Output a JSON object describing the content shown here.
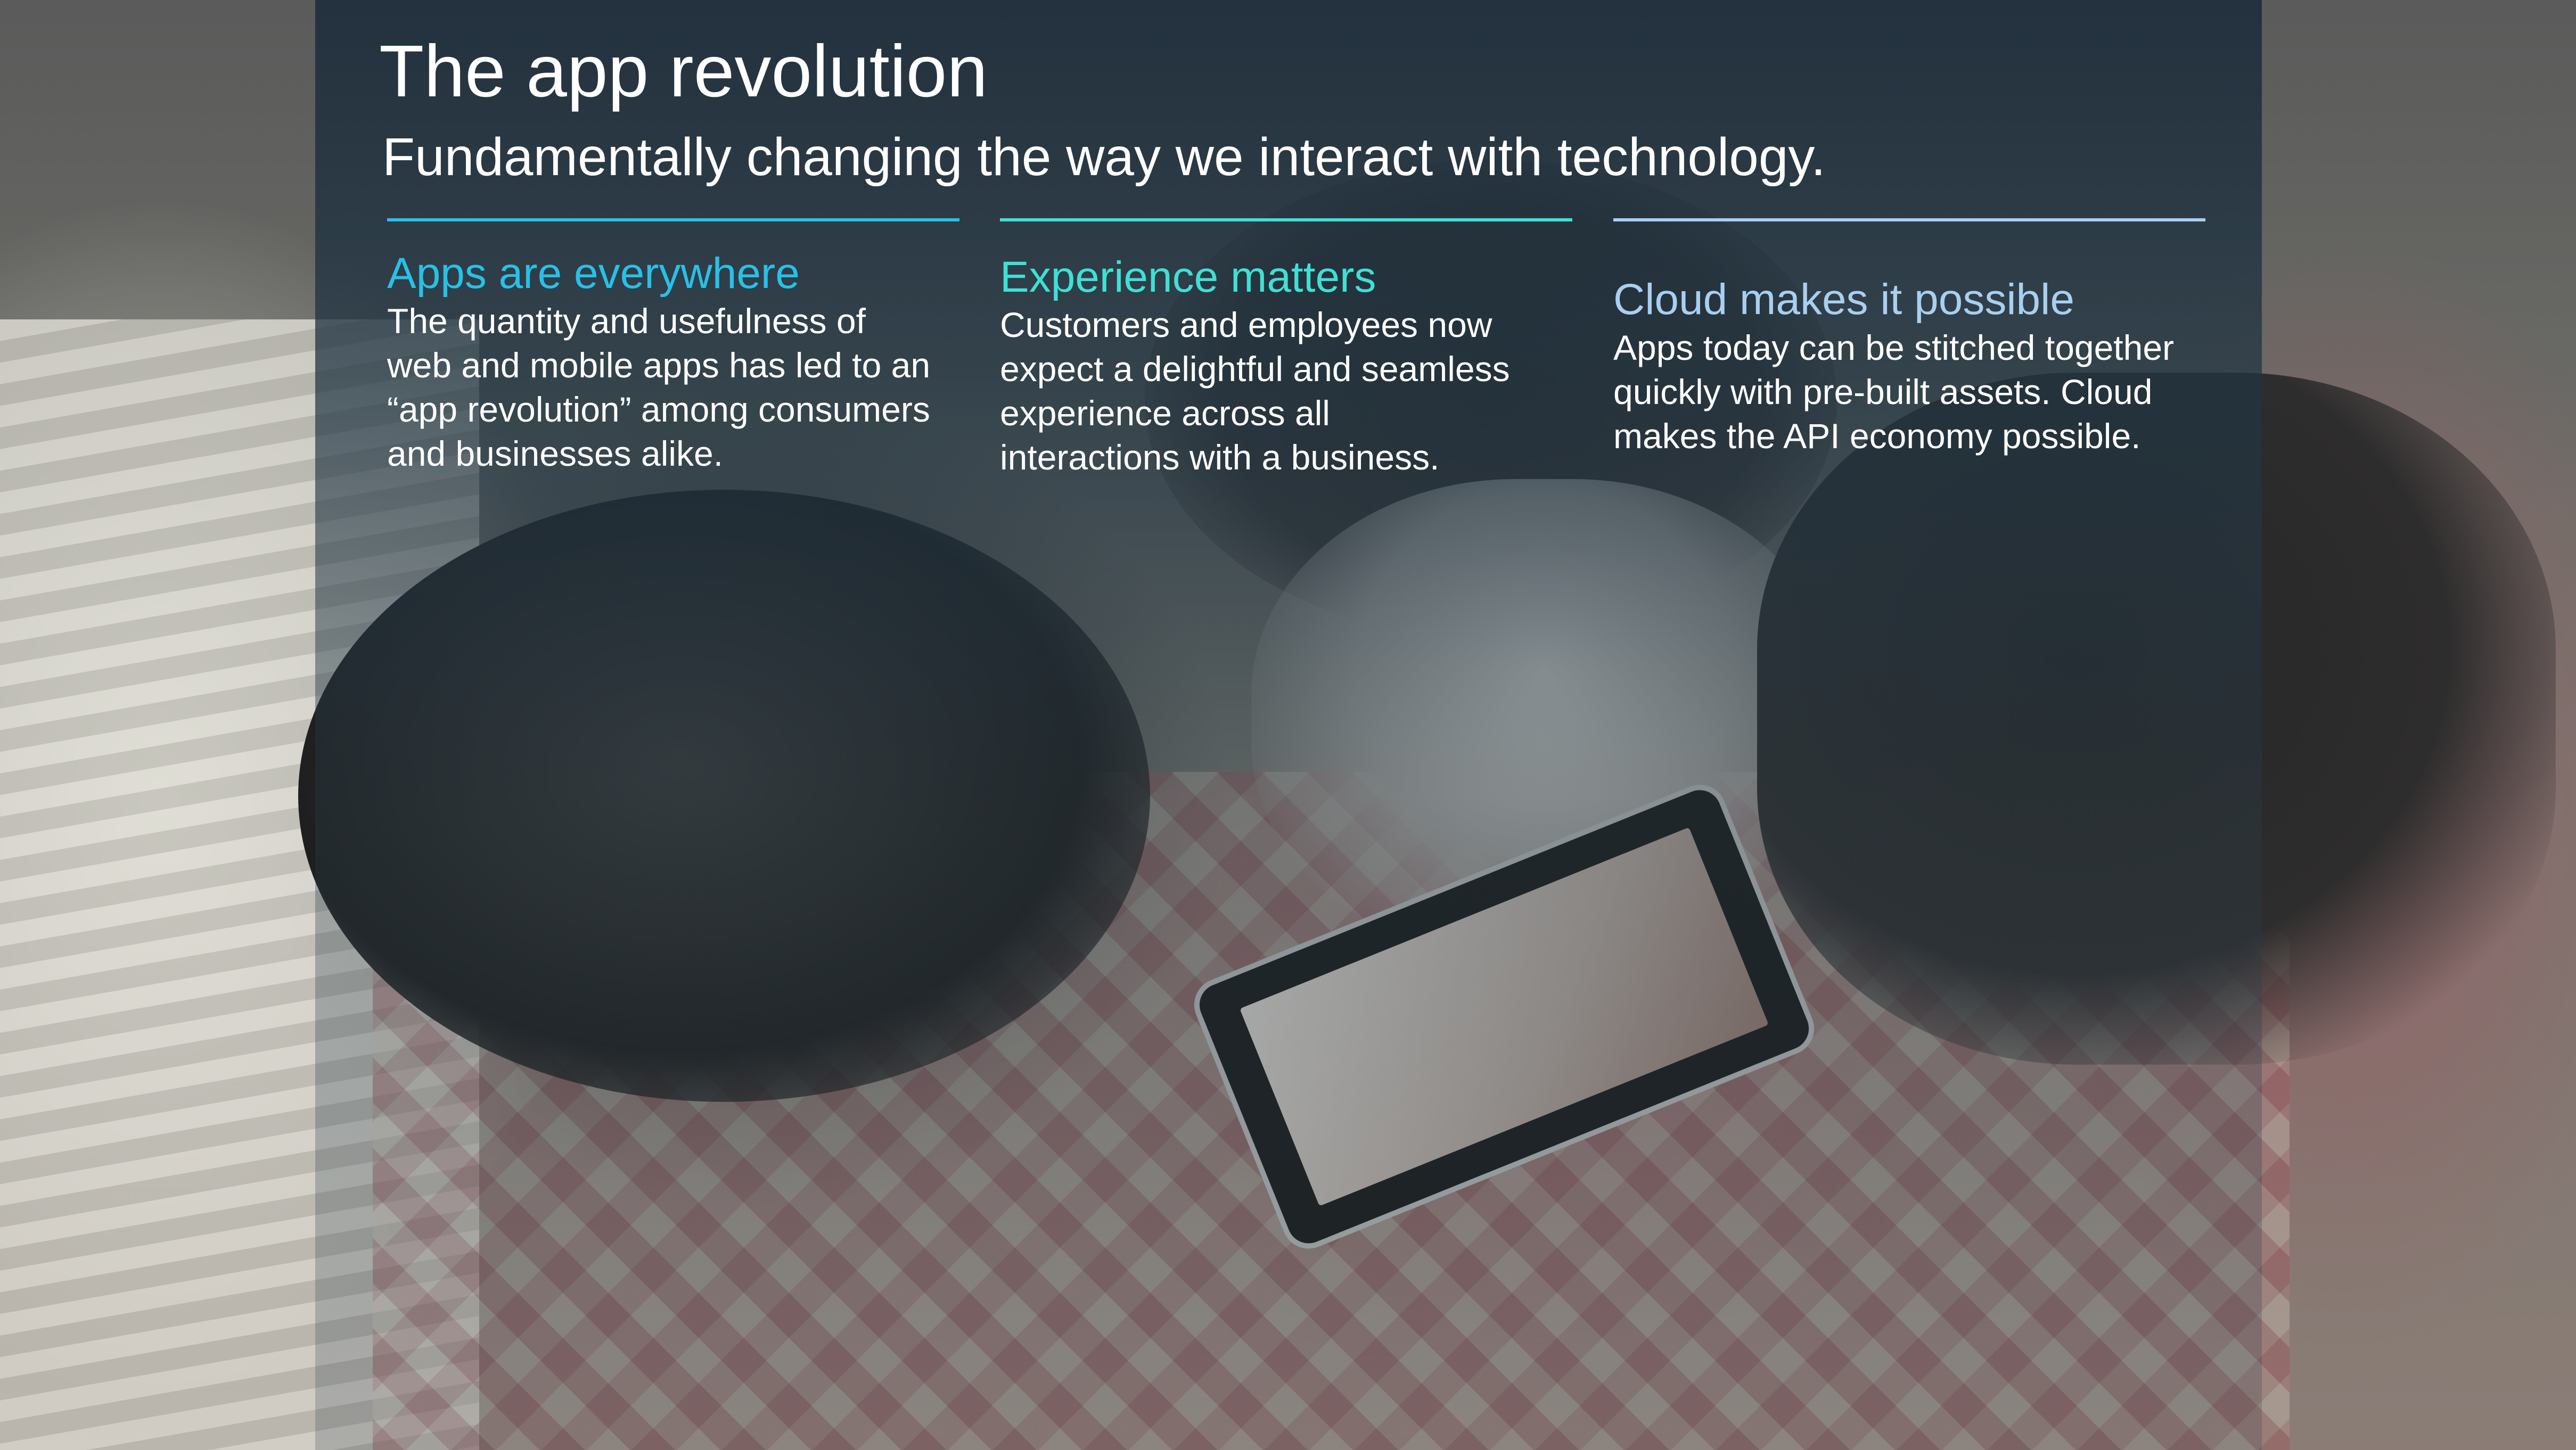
{
  "slide": {
    "title": "The app revolution",
    "subtitle": "Fundamentally changing the way we interact with technology."
  },
  "columns": [
    {
      "heading": "Apps are everywhere",
      "heading_color": "#29c0e6",
      "rule_color": "#29c0e6",
      "lines": [
        "The quantity and usefulness of",
        "web and mobile apps has led to an",
        "“app revolution” among consumers",
        "and businesses alike."
      ]
    },
    {
      "heading": "Experience matters",
      "heading_color": "#3fe0d4",
      "rule_color": "#3fe0d4",
      "lines": [
        "Customers and employees now",
        "expect a delightful and seamless",
        "experience across all",
        "interactions with a business."
      ]
    },
    {
      "heading": "Cloud makes it possible",
      "heading_color": "#a9cff0",
      "rule_color": "#a9cff0",
      "lines": [
        "Apps today can be stitched together",
        "quickly with pre-built  assets. Cloud",
        "makes the API economy possible."
      ]
    }
  ]
}
